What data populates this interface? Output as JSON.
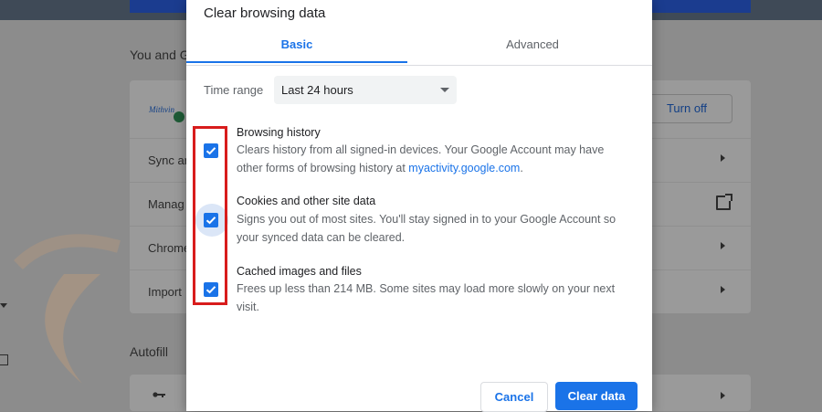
{
  "background": {
    "section_you_and": "You and G",
    "turn_off_button": "Turn off",
    "logo_text": "Mithvin",
    "rows": [
      {
        "label": "Sync ar",
        "icon": "chevron-right-icon"
      },
      {
        "label": "Manag",
        "icon": "open-in-new-icon"
      },
      {
        "label": "Chrome",
        "icon": "chevron-right-icon"
      },
      {
        "label": "Import",
        "icon": "chevron-right-icon"
      }
    ],
    "section_autofill": "Autofill",
    "autofill_icon": "key-icon"
  },
  "dialog": {
    "title": "Clear browsing data",
    "tabs": [
      {
        "label": "Basic",
        "selected": true
      },
      {
        "label": "Advanced",
        "selected": false
      }
    ],
    "time_range_label": "Time range",
    "time_range_value": "Last 24 hours",
    "options": [
      {
        "title": "Browsing history",
        "desc_line1": "Clears history from all signed-in devices. Your Google Account may have",
        "desc_line2_prefix": "other forms of browsing history at ",
        "link": "myactivity.google.com",
        "desc_line2_suffix": ".",
        "checked": true
      },
      {
        "title": "Cookies and other site data",
        "desc": "Signs you out of most sites. You'll stay signed in to your Google Account so your synced data can be cleared.",
        "checked": true
      },
      {
        "title": "Cached images and files",
        "desc": "Frees up less than 214 MB. Some sites may load more slowly on your next visit.",
        "checked": true
      }
    ],
    "cancel_button": "Cancel",
    "clear_button": "Clear data"
  },
  "colors": {
    "accent": "#1a73e8",
    "highlight_box": "#d81c1c"
  }
}
